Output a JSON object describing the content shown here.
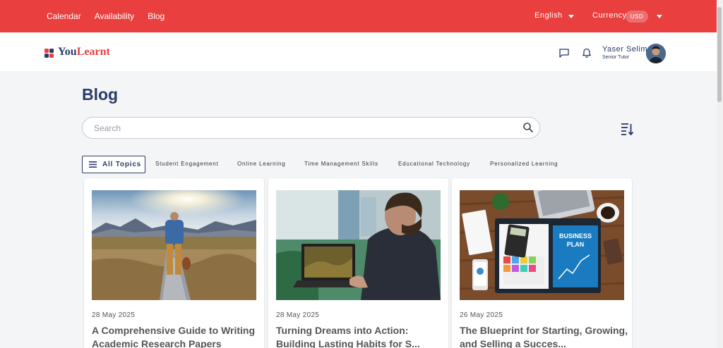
{
  "topbar": {
    "nav": [
      "Calendar",
      "Availability",
      "Blog"
    ],
    "language": "English",
    "currency_label": "Currency",
    "currency_value": "USD"
  },
  "header": {
    "logo_you": "You",
    "logo_learnt": "Learnt",
    "user_name": "Yaser Selim",
    "user_role": "Senior Tutor"
  },
  "page": {
    "title": "Blog",
    "search_placeholder": "Search",
    "all_topics": "All Topics",
    "topics": [
      "Student Engagement",
      "Online Learning",
      "Time Management Skills",
      "Educational Technology",
      "Personalized Learning"
    ]
  },
  "posts": [
    {
      "date": "28 May 2025",
      "title": "A Comprehensive Guide to Writing Academic Research Papers"
    },
    {
      "date": "28 May 2025",
      "title": "Turning Dreams into Action: Building Lasting Habits for S..."
    },
    {
      "date": "26 May 2025",
      "title": "The Blueprint for Starting, Growing, and Selling a Succes..."
    }
  ],
  "images": {
    "business_plan_line1": "BUSINESS",
    "business_plan_line2": "PLAN"
  },
  "colors": {
    "brand_red": "#e93f3f",
    "brand_navy": "#2b3a67"
  }
}
